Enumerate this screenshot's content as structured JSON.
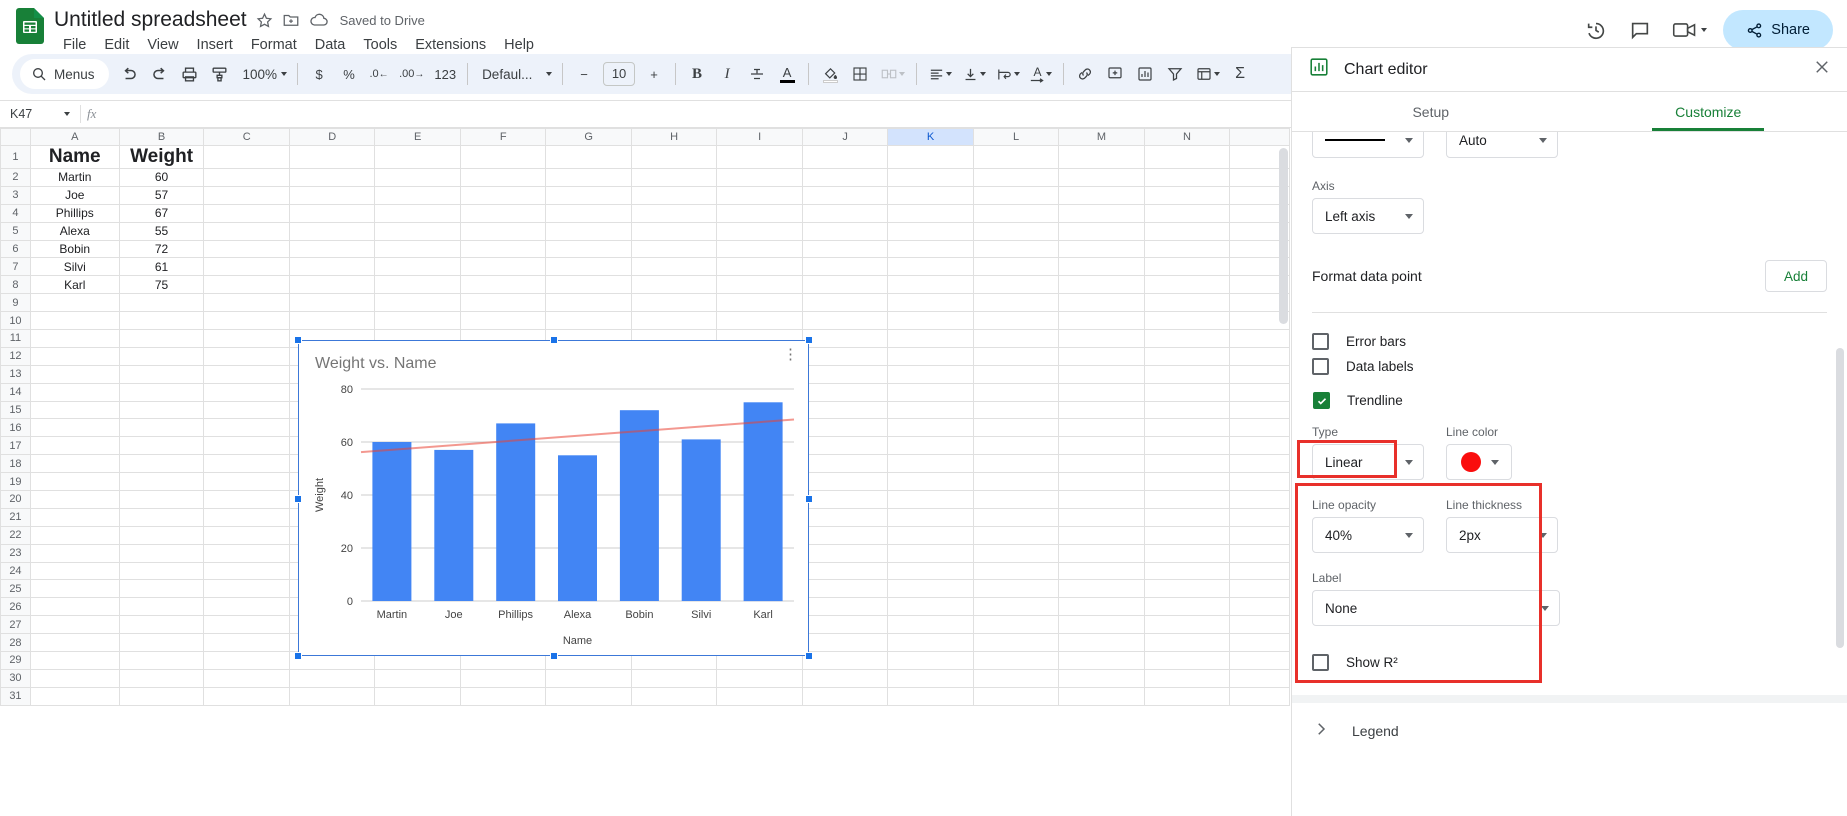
{
  "app": {
    "doc_title": "Untitled spreadsheet",
    "save_status": "Saved to Drive",
    "menus": [
      "File",
      "Edit",
      "View",
      "Insert",
      "Format",
      "Data",
      "Tools",
      "Extensions",
      "Help"
    ],
    "share_label": "Share"
  },
  "toolbar": {
    "menus_label": "Menus",
    "zoom": "100%",
    "number_format": "123",
    "font": "Defaul...",
    "font_size": "10",
    "currency": "$",
    "percent": "%",
    "dec_less": ".0",
    "dec_more": ".00",
    "bold": "B",
    "italic": "I",
    "sigma": "Σ"
  },
  "formula_bar": {
    "name_box": "K47",
    "fx": "fx",
    "value": ""
  },
  "grid": {
    "columns": [
      "A",
      "B",
      "C",
      "D",
      "E",
      "F",
      "G",
      "H",
      "I",
      "J",
      "K",
      "L",
      "M",
      "N"
    ],
    "selected_column": "K",
    "rows": [
      "1",
      "2",
      "3",
      "4",
      "5",
      "6",
      "7",
      "8",
      "9",
      "10",
      "11",
      "12",
      "13",
      "14",
      "15",
      "16",
      "17",
      "18",
      "19",
      "20",
      "21",
      "22",
      "23",
      "24",
      "25",
      "26",
      "27",
      "28",
      "29",
      "30",
      "31"
    ],
    "data": [
      [
        "Name",
        "Weight"
      ],
      [
        "Martin",
        "60"
      ],
      [
        "Joe",
        "57"
      ],
      [
        "Phillips",
        "67"
      ],
      [
        "Alexa",
        "55"
      ],
      [
        "Bobin",
        "72"
      ],
      [
        "Silvi",
        "61"
      ],
      [
        "Karl",
        "75"
      ]
    ]
  },
  "chart_data": {
    "type": "bar",
    "title": "Weight vs. Name",
    "xlabel": "Name",
    "ylabel": "Weight",
    "categories": [
      "Martin",
      "Joe",
      "Phillips",
      "Alexa",
      "Bobin",
      "Silvi",
      "Karl"
    ],
    "values": [
      60,
      57,
      67,
      55,
      72,
      61,
      75
    ],
    "yticks": [
      "0",
      "20",
      "40",
      "60",
      "80"
    ],
    "ylim": [
      0,
      80
    ],
    "grid": true,
    "legend": "none",
    "bar_color": "#4285f4",
    "trendline": {
      "type": "linear",
      "color": "#ea4335",
      "opacity": "40%",
      "thickness": "2px",
      "y_start": 56.2,
      "y_end": 68.5
    }
  },
  "panel": {
    "title": "Chart editor",
    "tabs": [
      {
        "label": "Setup",
        "active": false
      },
      {
        "label": "Customize",
        "active": true
      }
    ],
    "line_style_value": "",
    "line_weight_value": "Auto",
    "axis_label": "Axis",
    "axis_value": "Left axis",
    "format_data_point_label": "Format data point",
    "add_label": "Add",
    "checkboxes": [
      {
        "label": "Error bars",
        "checked": false
      },
      {
        "label": "Data labels",
        "checked": false
      },
      {
        "label": "Trendline",
        "checked": true
      }
    ],
    "trendline": {
      "type_label": "Type",
      "type_value": "Linear",
      "line_color_label": "Line color",
      "line_color_value": "#fa0d0d",
      "line_opacity_label": "Line opacity",
      "line_opacity_value": "40%",
      "line_thickness_label": "Line thickness",
      "line_thickness_value": "2px",
      "label_label": "Label",
      "label_value": "None"
    },
    "show_r2": {
      "label": "Show R²",
      "checked": false
    },
    "legend_section": "Legend"
  }
}
